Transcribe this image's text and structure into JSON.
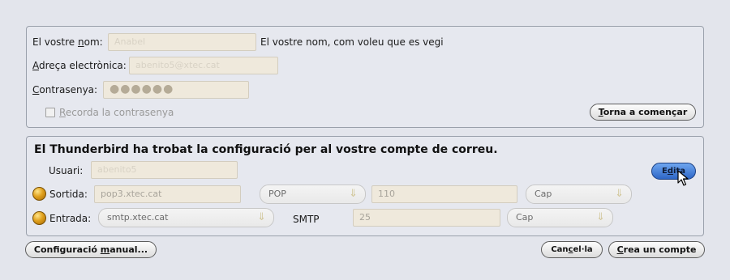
{
  "account": {
    "name_label": "El vostre nom:",
    "name_value": "Anabel",
    "name_hint": "El vostre nom, com voleu que es vegi",
    "email_label": "Adreça electrònica:",
    "email_value": "abenito5@xtec.cat",
    "password_label": "Contrasenya:",
    "password_value": "●●●●●●",
    "remember_label": "Recorda la contrasenya",
    "restart_button": "Torna a començar"
  },
  "config": {
    "heading": "El Thunderbird ha trobat la configuració per al vostre compte de correu.",
    "user_label": "Usuari:",
    "user_value": "abenito5",
    "edit_button": "Edita",
    "outgoing": {
      "label": "Sortida:",
      "server": "pop3.xtec.cat",
      "protocol": "POP",
      "port": "110",
      "security": "Cap"
    },
    "incoming": {
      "label": "Entrada:",
      "server": "smtp.xtec.cat",
      "protocol": "SMTP",
      "port": "25",
      "security": "Cap"
    }
  },
  "footer": {
    "manual_button": "Configuració manual...",
    "cancel_button": "Cancel·la",
    "create_button": "Crea un compte"
  },
  "icons": {
    "combo_arrow": "dropdown-arrow-icon",
    "status": "status-ball-icon",
    "cursor": "mouse-pointer-icon"
  }
}
